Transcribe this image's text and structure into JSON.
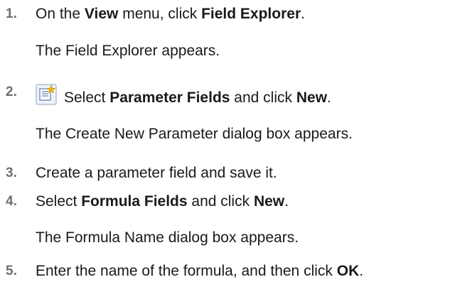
{
  "steps": [
    {
      "number": "1.",
      "parts": [
        "On the ",
        "View",
        " menu, click ",
        "Field Explorer",
        "."
      ],
      "result": "The Field Explorer appears."
    },
    {
      "number": "2.",
      "icon": "new-item-icon",
      "parts": [
        "Select ",
        "Parameter Fields",
        " and click ",
        "New",
        "."
      ],
      "result": "The Create New Parameter dialog box appears."
    },
    {
      "number": "3.",
      "parts": [
        "Create a parameter field and save it."
      ]
    },
    {
      "number": "4.",
      "parts": [
        "Select ",
        "Formula Fields",
        " and click ",
        "New",
        "."
      ],
      "result": "The Formula Name dialog box appears."
    },
    {
      "number": "5.",
      "parts": [
        "Enter the name of the formula, and then click ",
        "OK",
        "."
      ]
    }
  ]
}
